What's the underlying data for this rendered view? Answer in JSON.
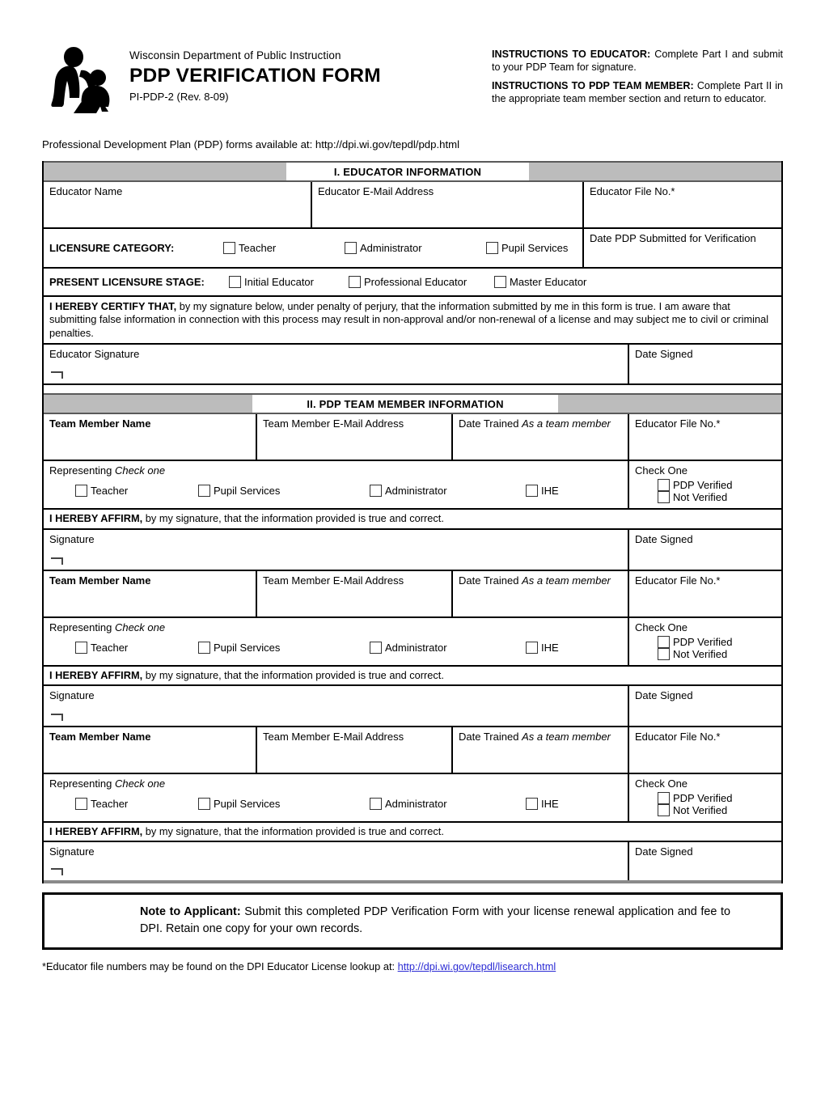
{
  "header": {
    "department": "Wisconsin Department of Public Instruction",
    "title": "PDP VERIFICATION FORM",
    "revision": "PI-PDP-2 (Rev. 8-09)",
    "logo_icon": "adult-reading-with-child-icon",
    "instructions": [
      {
        "bold": "INSTRUCTIONS TO EDUCATOR:",
        "text": " Complete Part I and submit to your PDP Team for signature."
      },
      {
        "bold": "INSTRUCTIONS TO PDP TEAM MEMBER:",
        "text": " Complete Part II in the appropriate team member section and return to educator."
      }
    ],
    "availability": "Professional Development Plan (PDP) forms available at:  http://dpi.wi.gov/tepdl/pdp.html"
  },
  "section1": {
    "bar_title": "I. EDUCATOR INFORMATION",
    "fields": {
      "educator_name": "Educator Name",
      "educator_email": "Educator E-Mail Address",
      "educator_file_no": "Educator File No.*",
      "date_submitted": "Date PDP Submitted for Verification"
    },
    "licensure_category": {
      "label": "LICENSURE CATEGORY:",
      "options": [
        "Teacher",
        "Administrator",
        "Pupil Services"
      ]
    },
    "licensure_stage": {
      "label": "PRESENT LICENSURE STAGE:",
      "options": [
        "Initial Educator",
        "Professional Educator",
        "Master Educator"
      ]
    },
    "certify": {
      "bold": "I HEREBY CERTIFY THAT,",
      "text": " by my signature below, under penalty of perjury, that the information submitted by me in this form is true. I am aware that submitting false information in connection with this process may result in non-approval and/or non-renewal of a license and may subject me to civil or criminal penalties."
    },
    "signature_label": "Educator Signature",
    "date_signed_label": "Date Signed"
  },
  "section2": {
    "bar_title": "II. PDP TEAM MEMBER INFORMATION",
    "field_labels": {
      "team_member_name": "Team Member Name",
      "team_member_email": "Team Member E-Mail Address",
      "date_trained": "Date Trained",
      "date_trained_italic": "As a team member",
      "educator_file_no": "Educator File No.*"
    },
    "representing": {
      "label": "Representing",
      "label_italic": "Check one",
      "options": [
        "Teacher",
        "Pupil Services",
        "Administrator",
        "IHE"
      ]
    },
    "check_one": {
      "label": "Check One",
      "options": [
        "PDP Verified",
        "Not Verified"
      ]
    },
    "affirm": {
      "bold": "I HEREBY AFFIRM,",
      "text": " by my signature, that the information provided is true and correct."
    },
    "signature_label": "Signature",
    "date_signed_label": "Date Signed",
    "blocks": [
      1,
      2,
      3
    ]
  },
  "note": {
    "bold": "Note to Applicant:",
    "text": " Submit this completed PDP Verification Form with your license renewal application and fee to DPI. Retain one copy for your own records."
  },
  "footnote": {
    "text": "*Educator file numbers may be found on the DPI Educator License lookup at: ",
    "link": "http://dpi.wi.gov/tepdl/lisearch.html"
  },
  "colors": {
    "gray_bar": "#bcbcbc",
    "gray_bar_edge": "#5a5a5a",
    "link": "#2b2bd4",
    "border": "#000000"
  }
}
